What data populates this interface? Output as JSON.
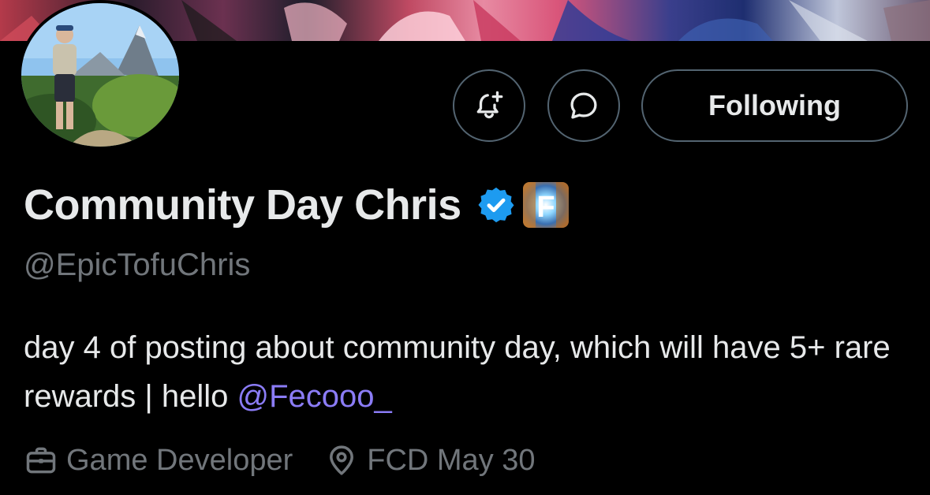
{
  "profile": {
    "display_name": "Community Day Chris",
    "handle": "@EpicTofuChris",
    "verified": true,
    "affiliate_badge": "F"
  },
  "actions": {
    "notify_icon": "bell-plus-icon",
    "message_icon": "message-bubble-icon",
    "following_label": "Following"
  },
  "bio": {
    "text": "day 4 of posting about community day, which will have 5+ rare rewards | hello ",
    "mention": "@Fecooo_"
  },
  "meta": {
    "profession": "Game Developer",
    "profession_icon": "briefcase-icon",
    "location": "FCD May 30",
    "location_icon": "location-pin-icon"
  },
  "colors": {
    "background": "#000000",
    "text": "#e7e9ea",
    "secondary_text": "#71767b",
    "mention": "#8b7cf6",
    "verified_badge": "#1d9bf0",
    "button_border": "#536471"
  }
}
